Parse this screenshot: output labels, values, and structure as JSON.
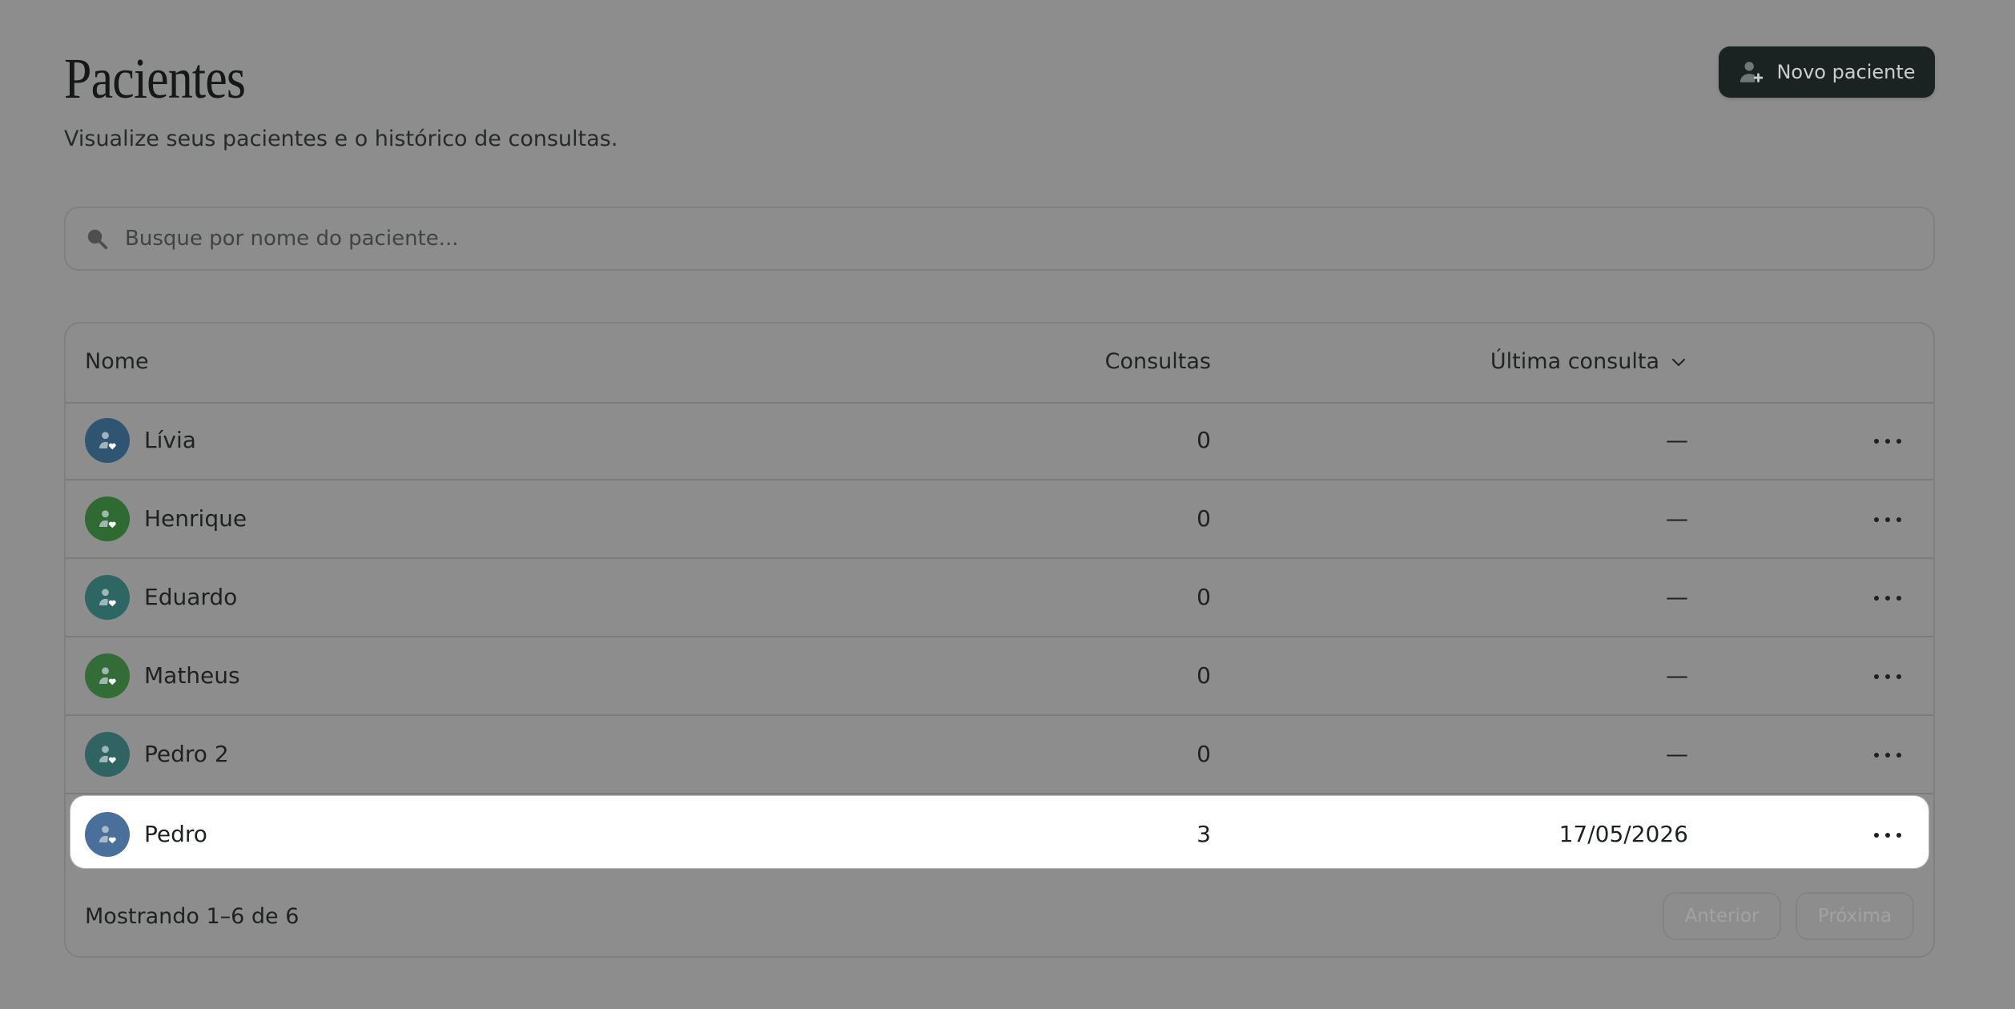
{
  "header": {
    "title": "Pacientes",
    "subtitle": "Visualize seus pacientes e o histórico de consultas.",
    "new_button_label": "Novo paciente"
  },
  "search": {
    "placeholder": "Busque por nome do paciente...",
    "value": ""
  },
  "table": {
    "columns": {
      "name": "Nome",
      "consultations": "Consultas",
      "last_consultation": "Última consulta"
    },
    "rows": [
      {
        "name": "Lívia",
        "consultations": "0",
        "last": "—",
        "avatar_color": "#2f5572"
      },
      {
        "name": "Henrique",
        "consultations": "0",
        "last": "—",
        "avatar_color": "#2f6a32"
      },
      {
        "name": "Eduardo",
        "consultations": "0",
        "last": "—",
        "avatar_color": "#2e6663"
      },
      {
        "name": "Matheus",
        "consultations": "0",
        "last": "—",
        "avatar_color": "#336c36"
      },
      {
        "name": "Pedro 2",
        "consultations": "0",
        "last": "—",
        "avatar_color": "#2f6462"
      },
      {
        "name": "Pedro",
        "consultations": "3",
        "last": "17/05/2026",
        "avatar_color": "#4a6f9b",
        "highlighted": true
      }
    ]
  },
  "footer": {
    "showing": "Mostrando 1–6 de 6",
    "prev_label": "Anterior",
    "next_label": "Próxima"
  },
  "colors": {
    "overlay_bg": "#8d8d8d",
    "primary_button": "#1a2321",
    "highlight_row": "#ffffff"
  },
  "icons": {
    "new_button": "user-plus-icon",
    "search": "search-icon",
    "sort": "chevron-down-icon",
    "avatar": "user-heart-icon",
    "row_menu": "more-horizontal-icon"
  }
}
